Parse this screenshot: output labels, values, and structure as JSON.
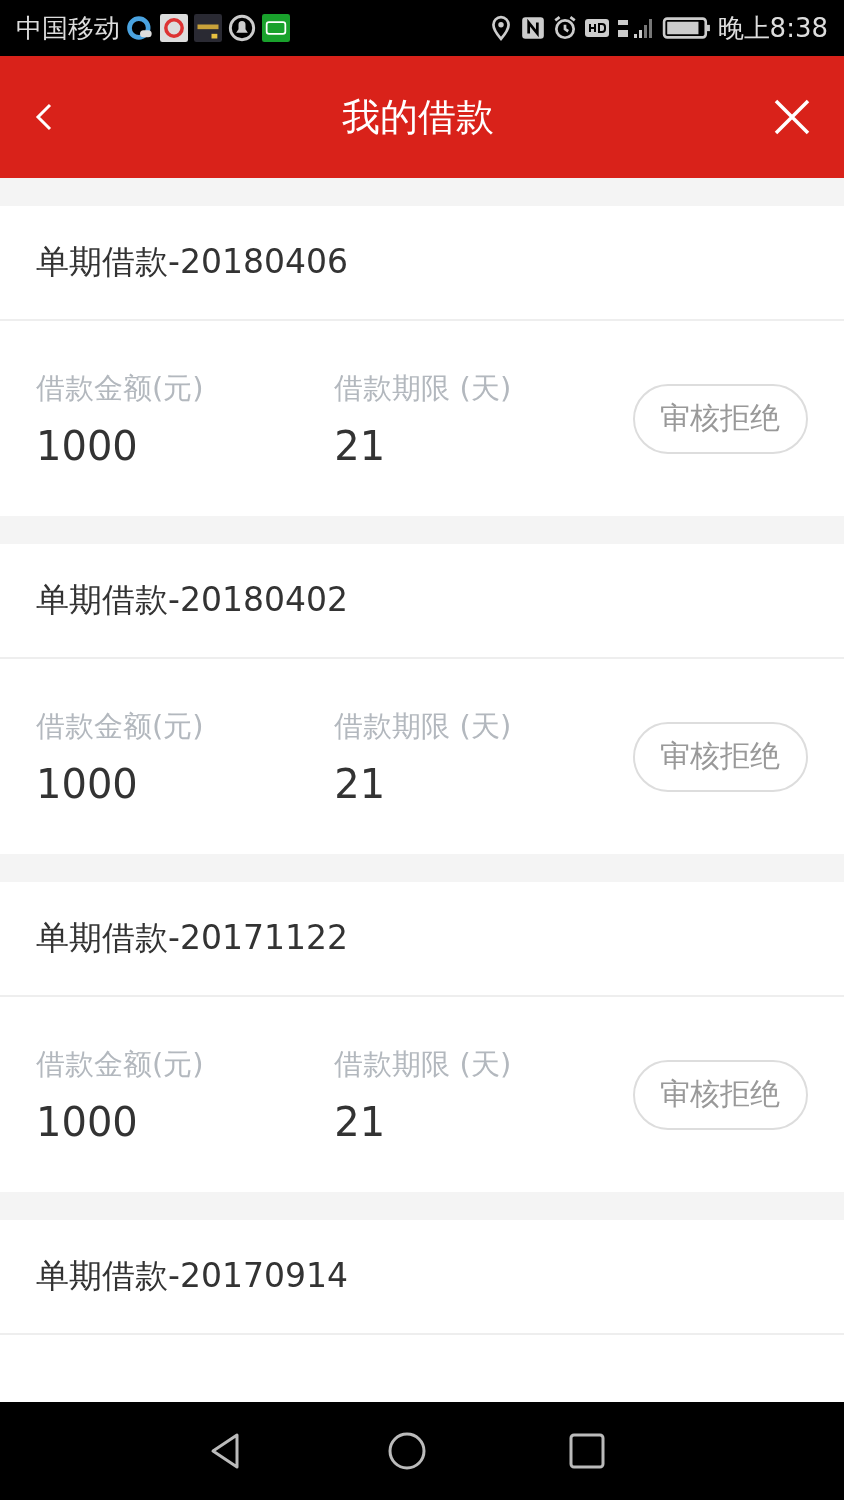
{
  "status_bar": {
    "carrier": "中国移动",
    "time": "晚上8:38"
  },
  "header": {
    "title": "我的借款"
  },
  "loans": [
    {
      "title": "单期借款-20180406",
      "amount_label": "借款金额(元)",
      "amount": "1000",
      "term_label": "借款期限 (天)",
      "term": "21",
      "status": "审核拒绝"
    },
    {
      "title": "单期借款-20180402",
      "amount_label": "借款金额(元)",
      "amount": "1000",
      "term_label": "借款期限 (天)",
      "term": "21",
      "status": "审核拒绝"
    },
    {
      "title": "单期借款-20171122",
      "amount_label": "借款金额(元)",
      "amount": "1000",
      "term_label": "借款期限 (天)",
      "term": "21",
      "status": "审核拒绝"
    },
    {
      "title": "单期借款-20170914"
    }
  ]
}
